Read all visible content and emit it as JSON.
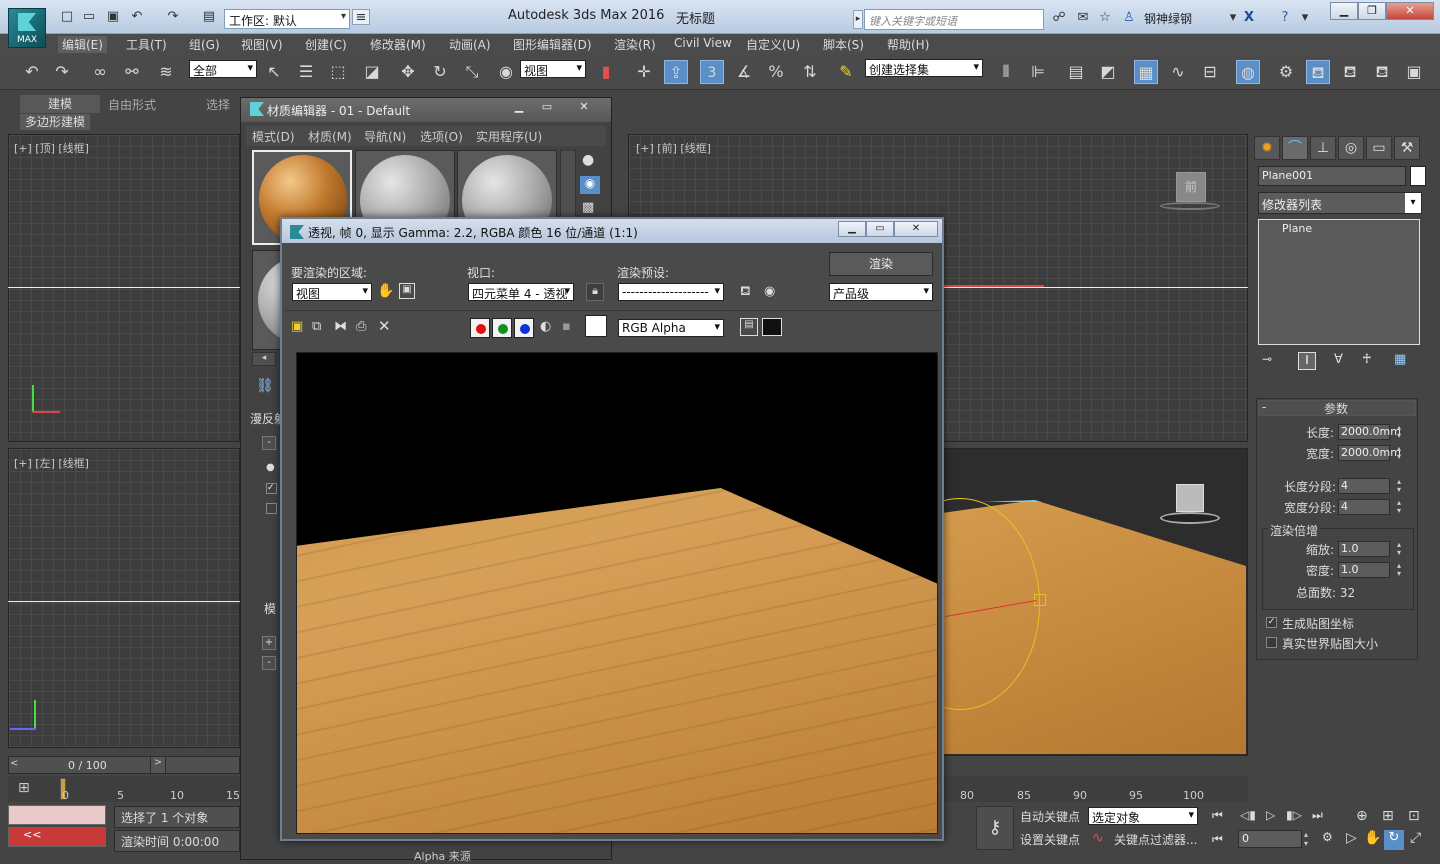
{
  "app": {
    "logo_label": "MAX",
    "title": "Autodesk 3ds Max 2016",
    "document": "无标题",
    "workspace_prefix": "工作区: 默认",
    "search_placeholder": "键入关键字或短语",
    "user": "钢神绿钢"
  },
  "menus": [
    "编辑(E)",
    "工具(T)",
    "组(G)",
    "视图(V)",
    "创建(C)",
    "修改器(M)",
    "动画(A)",
    "图形编辑器(D)",
    "渲染(R)",
    "Civil View",
    "自定义(U)",
    "脚本(S)",
    "帮助(H)"
  ],
  "toolbar": {
    "selection_filter": "全部",
    "ref_coord": "视图",
    "named_selection": "创建选择集",
    "snap_label": "3"
  },
  "ribbon": {
    "tabs": [
      "建模",
      "自由形式",
      "选择"
    ],
    "panel": "多边形建模"
  },
  "viewports": {
    "top": "[+] [顶] [线框]",
    "front": "[+] [前] [线框]",
    "left": "[+] [左] [线框]",
    "navcube_front": "前"
  },
  "material_editor": {
    "title": "材质编辑器 - 01 - Default",
    "menus": [
      "模式(D)",
      "材质(M)",
      "导航(N)",
      "选项(O)",
      "实用程序(U)"
    ],
    "side_labels": [
      "漫反射",
      "模"
    ],
    "bottom_label": "Alpha 来源"
  },
  "render_window": {
    "title": "透视, 帧 0, 显示 Gamma: 2.2, RGBA 颜色 16 位/通道 (1:1)",
    "area_label": "要渲染的区域:",
    "area_value": "视图",
    "viewport_label": "视口:",
    "viewport_value": "四元菜单 4 - 透视",
    "preset_label": "渲染预设:",
    "preset_value": "--------------------",
    "render_button": "渲染",
    "quality_value": "产品级",
    "channel_value": "RGB Alpha"
  },
  "command_panel": {
    "object_name": "Plane001",
    "modifier_list": "修改器列表",
    "stack_item": "Plane",
    "rollout_title": "参数",
    "length_label": "长度:",
    "length_value": "2000.0mm",
    "width_label": "宽度:",
    "width_value": "2000.0mm",
    "length_segs_label": "长度分段:",
    "length_segs_value": "4",
    "width_segs_label": "宽度分段:",
    "width_segs_value": "4",
    "render_mult_title": "渲染倍增",
    "scale_label": "缩放:",
    "scale_value": "1.0",
    "density_label": "密度:",
    "density_value": "1.0",
    "total_faces": "总面数: 32",
    "gen_map_coords": "生成贴图坐标",
    "real_world": "真实世界贴图大小"
  },
  "timeline": {
    "frame": "0 / 100",
    "ticks_left": [
      "0",
      "5",
      "10",
      "15"
    ],
    "ticks_right": [
      "80",
      "85",
      "90",
      "95",
      "100"
    ]
  },
  "status": {
    "selected": "选择了 1 个对象",
    "render_time": "渲染时间 0:00:00",
    "auto_key": "自动关键点",
    "set_key": "设置关键点",
    "selection_mode": "选定对象",
    "key_filters": "关键点过滤器...",
    "current_frame": "0"
  },
  "colors": {
    "wood_light": "#d49a4c",
    "wood_dark": "#b57428",
    "accent": "#5a8ec6"
  }
}
